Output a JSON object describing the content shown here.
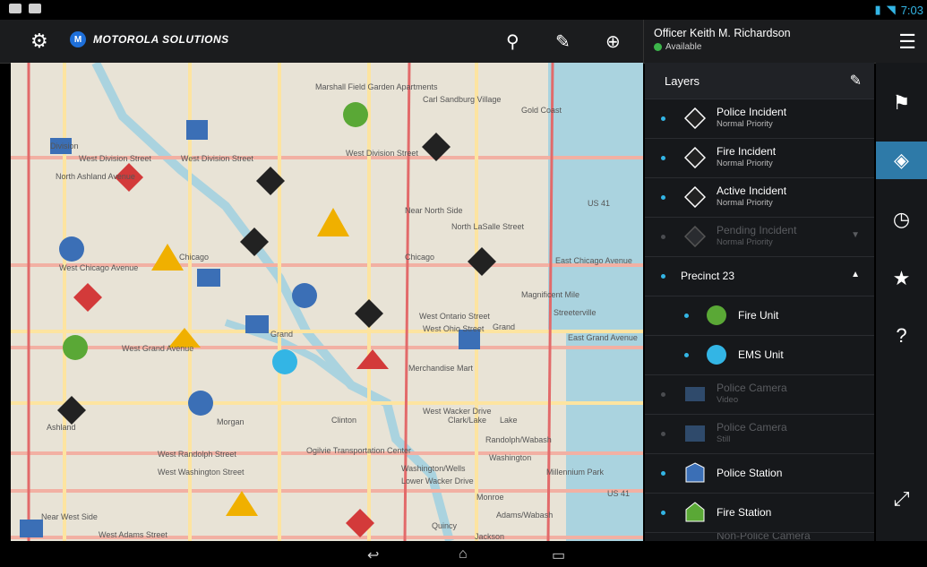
{
  "statusbar": {
    "time": "7:03"
  },
  "appbar": {
    "brand": "MOTOROLA SOLUTIONS",
    "brand_logo": "M",
    "officer_name": "Officer Keith M. Richardson",
    "officer_status": "Available"
  },
  "map": {
    "street_labels": [
      "Marshall Field Garden Apartments",
      "Carl Sandburg Village",
      "Gold Coast",
      "West Division Street",
      "West Division Street",
      "West Division Street",
      "Near North Side",
      "US 41",
      "West Chicago Avenue",
      "Chicago",
      "Chicago",
      "East Chicago Avenue",
      "Magnificent Mile",
      "West Ontario Street",
      "Streeterville",
      "West Ohio Street",
      "Grand",
      "East Grand Avenue",
      "West Grand Avenue",
      "Grand",
      "Merchandise Mart",
      "West Wacker Drive",
      "Clark/Lake",
      "Lake",
      "Ashland",
      "Morgan",
      "Clinton",
      "Randolph/Wabash",
      "West Randolph Street",
      "Ogilvie Transportation Center",
      "West Washington Street",
      "Washington",
      "Washington/Wells",
      "Millennium Park",
      "US 41",
      "Monroe",
      "Adams/Wabash",
      "Quincy",
      "Jackson",
      "West Adams Street",
      "Near West Side",
      "North Ashland Avenue",
      "North LaSalle Street",
      "Lower Wacker Drive",
      "Division"
    ]
  },
  "layers": {
    "title": "Layers",
    "items": [
      {
        "label": "Police Incident",
        "sub": "Normal Priority"
      },
      {
        "label": "Fire Incident",
        "sub": "Normal Priority"
      },
      {
        "label": "Active Incident",
        "sub": "Normal Priority"
      },
      {
        "label": "Pending Incident",
        "sub": "Normal Priority"
      },
      {
        "label": "Precinct 23"
      },
      {
        "label": "Fire Unit"
      },
      {
        "label": "EMS Unit"
      },
      {
        "label": "Police Camera",
        "sub": "Video"
      },
      {
        "label": "Police Camera",
        "sub": "Still"
      },
      {
        "label": "Police Station"
      },
      {
        "label": "Fire Station"
      },
      {
        "label": "Non-Police Camera"
      }
    ]
  },
  "colors": {
    "accent": "#33b5e5",
    "active_rail": "#2e7aa8",
    "available": "#3cb54a"
  }
}
